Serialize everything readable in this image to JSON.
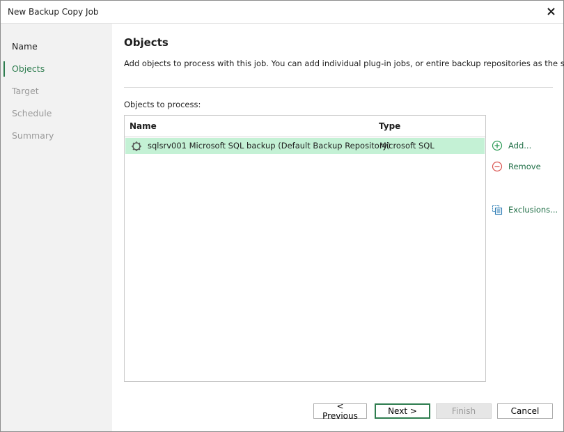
{
  "window": {
    "title": "New Backup Copy Job"
  },
  "sidebar": {
    "items": [
      {
        "label": "Name",
        "state": "done"
      },
      {
        "label": "Objects",
        "state": "active"
      },
      {
        "label": "Target",
        "state": "disabled"
      },
      {
        "label": "Schedule",
        "state": "disabled"
      },
      {
        "label": "Summary",
        "state": "disabled"
      }
    ]
  },
  "main": {
    "title": "Objects",
    "description": "Add objects to process with this job. You can add individual plug-in jobs, or entire backup repositories as the source.",
    "objects_label": "Objects to process:",
    "grid": {
      "columns": [
        "Name",
        "Type"
      ],
      "rows": [
        {
          "name": "sqlsrv001 Microsoft SQL backup (Default Backup Repository)",
          "type": "Microsoft SQL",
          "selected": true,
          "icon": "plugin-job-icon"
        }
      ]
    },
    "actions": {
      "add": "Add...",
      "remove": "Remove",
      "exclusions": "Exclusions..."
    }
  },
  "footer": {
    "previous": "< Previous",
    "next": "Next >",
    "finish": "Finish",
    "cancel": "Cancel"
  },
  "colors": {
    "accent": "#2e7d4f",
    "selected_row": "#c4f1d5",
    "remove_icon": "#d9534f"
  }
}
